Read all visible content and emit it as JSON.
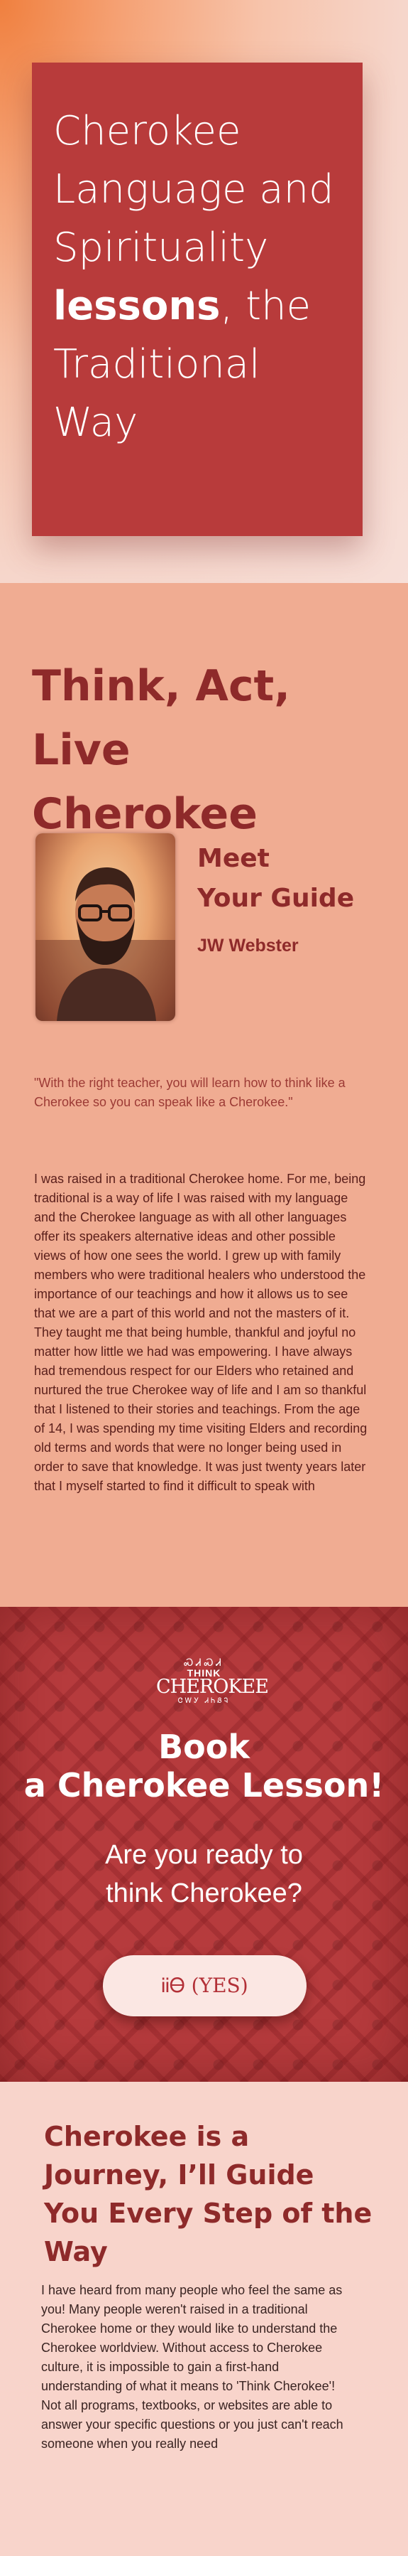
{
  "hero": {
    "title_line1": "Cherokee",
    "title_line2": "Language and",
    "title_line3": "Spirituality",
    "title_bold": "lessons",
    "title_after_bold": ", the",
    "title_line5": "Traditional",
    "title_line6": "Way"
  },
  "guide": {
    "heading_line1": "Think, Act, Live",
    "heading_line2": "Cherokee",
    "meet_line1": "Meet",
    "meet_line2": "Your Guide",
    "name": "JW Webster",
    "quote": "\"With the right teacher, you will learn how to think like a Cherokee so you can speak like a Cherokee.\"",
    "bio": "I was raised in a traditional Cherokee home. For me, being traditional is a way of life I was raised with my language and the Cherokee language as with all other languages offer its speakers alternative ideas and other possible views of how one sees the world. I grew up with family members who were traditional healers who understood the importance of our teachings and how it allows us to see that we are a part of this world and not the masters of it. They taught me that being humble, thankful and joyful no matter how little we had was empowering. I have always had tremendous respect for our Elders who retained and nurtured the true Cherokee way of life and I am so thankful that I listened to their stories and teachings. From the age of 14, I was spending my time visiting Elders and recording old terms and words that were no longer being used in order to save that knowledge. It was just twenty years later that I myself started to find it difficult to speak with"
  },
  "book": {
    "logo_mark": "ᏍᏗᏍᏗ",
    "logo_think": "THINK",
    "logo_cherokee": "CHEROKEE",
    "logo_syllabary": "ᏣᎳᎩ ᏗᏂᏰᎸ",
    "title_line1": "Book",
    "title_line2": "a Cherokee Lesson!",
    "subtitle_line1": "Are you ready to",
    "subtitle_line2": "think Cherokee?",
    "button_label": "ᎥᎥᎾ (YES)"
  },
  "journey": {
    "heading": "Cherokee is a Journey, I’ll Guide You Every Step of the Way",
    "body": "I have heard from many people who feel the same as you! Many people weren't raised in a traditional Cherokee home or they would like to understand the Cherokee worldview. Without access to Cherokee culture, it is impossible to gain a first-hand understanding of what it means to 'Think Cherokee'! Not all programs, textbooks, or websites are able to answer your specific questions or you just can't reach someone when you really need"
  }
}
